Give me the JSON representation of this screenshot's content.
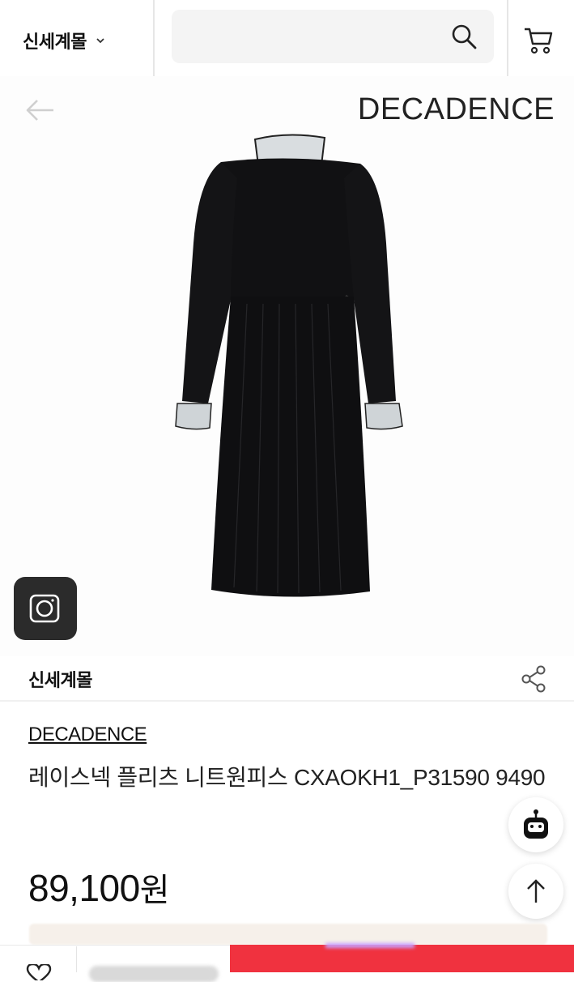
{
  "header": {
    "mall_label": "신세계몰",
    "search_placeholder": ""
  },
  "hero": {
    "brand": "DECADENCE"
  },
  "store": {
    "name": "신세계몰"
  },
  "product": {
    "brand": "DECADENCE",
    "title": "레이스넥 플리츠 니트원피스 CXAOKH1_P31590 9490",
    "price": "89,100",
    "currency": "원"
  },
  "icons": {
    "back": "arrow-left-icon",
    "search": "search-icon",
    "cart": "cart-icon",
    "camera": "camera-icon",
    "share": "share-icon",
    "chatbot": "chatbot-icon",
    "scroll_top": "arrow-up-icon",
    "wishlist": "heart-icon"
  },
  "colors": {
    "buy_button": "#f0323f",
    "dress": "#101012",
    "camera_button": "#2b2b2b"
  }
}
